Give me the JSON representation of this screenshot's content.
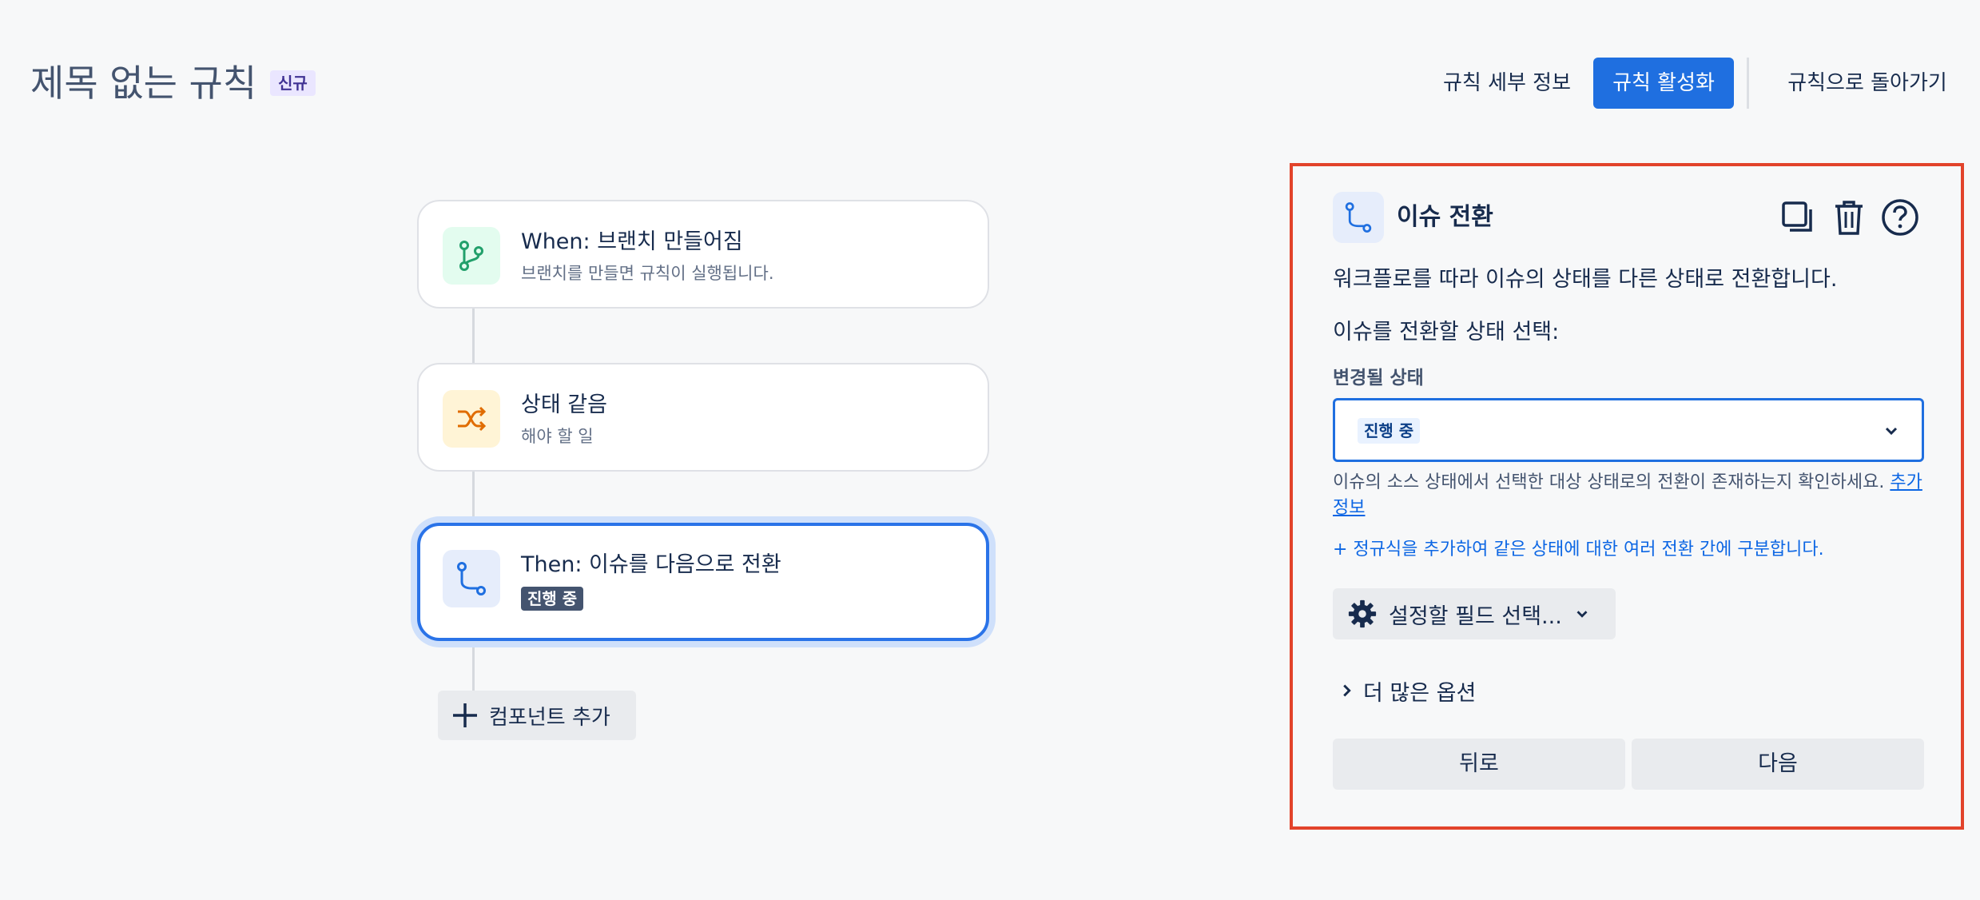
{
  "header": {
    "title": "제목 없는 규칙",
    "badge": "신규",
    "details_label": "규칙 세부 정보",
    "activate_label": "규칙 활성화",
    "back_label": "규칙으로 돌아가기"
  },
  "flow": {
    "nodes": [
      {
        "title": "When: 브랜치 만들어짐",
        "subtitle": "브랜치를 만들면 규칙이 실행됩니다.",
        "icon": "branch-icon"
      },
      {
        "title": "상태 같음",
        "subtitle": "해야 할 일",
        "icon": "shuffle-icon"
      },
      {
        "title": "Then: 이슈를 다음으로 전환",
        "status": "진행 중",
        "icon": "transition-icon"
      }
    ],
    "add_component_label": "컴포넌트 추가"
  },
  "panel": {
    "title": "이슈 전환",
    "description": "워크플로를 따라 이슈의 상태를 다른 상태로 전환합니다.",
    "section_label": "이슈를 전환할 상태 선택:",
    "field_label": "변경될 상태",
    "selected_status": "진행 중",
    "helper_text": "이슈의 소스 상태에서 선택한 대상 상태로의 전환이 존재하는지 확인하세요. ",
    "helper_link": "추가 정보",
    "regex_link": "+ 정규식을 추가하여 같은 상태에 대한 여러 전환 간에 구분합니다.",
    "field_select_label": "설정할 필드 선택...",
    "more_options_label": "더 많은 옵션",
    "prev_label": "뒤로",
    "next_label": "다음"
  },
  "colors": {
    "primary": "#1f6fe0",
    "panel_border": "#e2432b",
    "selected_node_border": "#2a73e8",
    "branch_icon_bg": "#e3fcef",
    "shuffle_icon_bg": "#fff4d6"
  }
}
